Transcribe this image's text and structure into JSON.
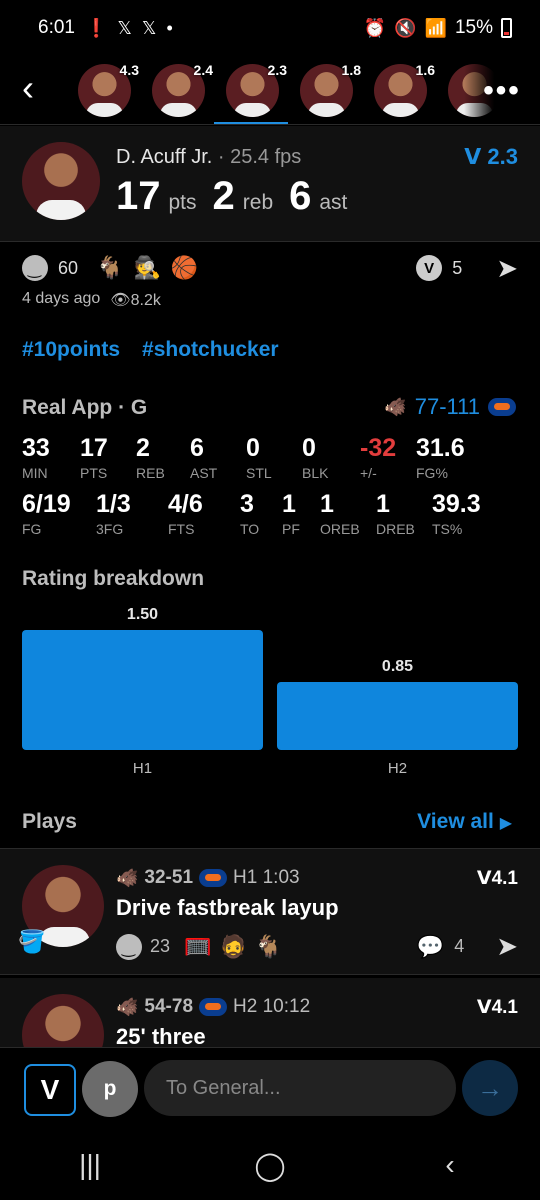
{
  "status_bar": {
    "time": "6:01",
    "battery": "15%"
  },
  "strip": {
    "players": [
      {
        "rating": "4.3"
      },
      {
        "rating": "2.4"
      },
      {
        "rating": "2.3"
      },
      {
        "rating": "1.8"
      },
      {
        "rating": "1.6"
      },
      {
        "rating": ""
      }
    ]
  },
  "header": {
    "name": "D. Acuff Jr.",
    "fps": "25.4 fps",
    "pts": "17",
    "pts_label": "pts",
    "reb": "2",
    "reb_label": "reb",
    "ast": "6",
    "ast_label": "ast",
    "rating": "2.3"
  },
  "reactions": {
    "smile_count": "60",
    "v_count": "5",
    "time_ago": "4 days ago",
    "views": "8.2k"
  },
  "tags": [
    "#10points",
    "#shotchucker"
  ],
  "box": {
    "title": "Real App · G",
    "score": "77-111",
    "row1": [
      {
        "v": "33",
        "k": "MIN"
      },
      {
        "v": "17",
        "k": "PTS"
      },
      {
        "v": "2",
        "k": "REB"
      },
      {
        "v": "6",
        "k": "AST"
      },
      {
        "v": "0",
        "k": "STL"
      },
      {
        "v": "0",
        "k": "BLK"
      },
      {
        "v": "-32",
        "k": "+/-"
      },
      {
        "v": "31.6",
        "k": "FG%"
      }
    ],
    "row2": [
      {
        "v": "6/19",
        "k": "FG"
      },
      {
        "v": "1/3",
        "k": "3FG"
      },
      {
        "v": "4/6",
        "k": "FTS"
      },
      {
        "v": "3",
        "k": "TO"
      },
      {
        "v": "1",
        "k": "PF"
      },
      {
        "v": "1",
        "k": "OREB"
      },
      {
        "v": "1",
        "k": "DREB"
      },
      {
        "v": "39.3",
        "k": "TS%"
      }
    ]
  },
  "rating_breakdown": {
    "title": "Rating breakdown"
  },
  "chart_data": {
    "type": "bar",
    "categories": [
      "H1",
      "H2"
    ],
    "values": [
      1.5,
      0.85
    ],
    "value_labels": [
      "1.50",
      "0.85"
    ],
    "title": "Rating breakdown",
    "ylim": [
      0,
      1.5
    ]
  },
  "plays": {
    "title": "Plays",
    "view_all": "View all",
    "items": [
      {
        "score": "32-51",
        "time": "H1 1:03",
        "title": "Drive fastbreak layup",
        "rating": "4.1",
        "smile_count": "23",
        "comment_count": "4"
      },
      {
        "score": "54-78",
        "time": "H2 10:12",
        "title": "25' three",
        "rating": "4.1",
        "smile_count": "",
        "comment_count": ""
      }
    ]
  },
  "composer": {
    "avatar_letter": "p",
    "placeholder": "To General..."
  },
  "colors": {
    "accent": "#1f8ee0",
    "bar": "#0f86dd",
    "negative": "#e23d3d"
  }
}
